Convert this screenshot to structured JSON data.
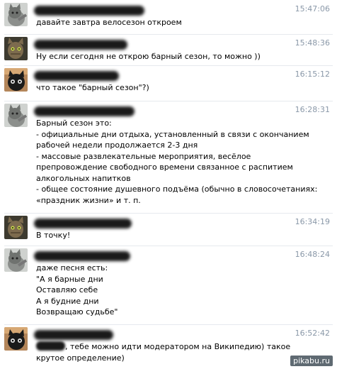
{
  "messages": [
    {
      "avatar": "grey-cat-avatar",
      "time": "15:47:06",
      "lines": [
        "давайте завтра велосезон откроем"
      ]
    },
    {
      "avatar": "tabby-cat-avatar",
      "time": "15:48:36",
      "lines": [
        "Ну если сегодня не открою барный сезон, то можно ))"
      ]
    },
    {
      "avatar": "black-cat-avatar",
      "time": "16:15:12",
      "lines": [
        "что такое \"барный сезон\"?)"
      ]
    },
    {
      "avatar": "grey-cat-avatar",
      "time": "16:28:31",
      "lines": [
        "Барный сезон это:",
        "- официальные дни отдыха, установленный в связи с окончанием",
        "рабочей недели продолжается 2-3 дня",
        "- массовые развлекательные мероприятия, весёлое",
        "препровождение свободного времени связанное с распитием",
        "алкогольных напитков",
        "- общее состояние душевного подъёма (обычно в словосочетаниях:",
        "«праздник жизни» и т. п."
      ]
    },
    {
      "avatar": "tabby-cat-avatar",
      "time": "16:34:19",
      "lines": [
        "В точку!"
      ]
    },
    {
      "avatar": "grey-cat-avatar",
      "time": "16:48:24",
      "lines": [
        "даже песня есть:",
        "\"А я барные дни",
        "Оставляю себе",
        "А я будние дни",
        "Возвращаю судьбе\""
      ]
    },
    {
      "avatar": "black-cat-avatar",
      "time": "16:52:42",
      "lines": [
        ", тебе можно идти модератором на Википедию) такое",
        "крутое определение)"
      ]
    }
  ],
  "watermark": "pikabu.ru"
}
